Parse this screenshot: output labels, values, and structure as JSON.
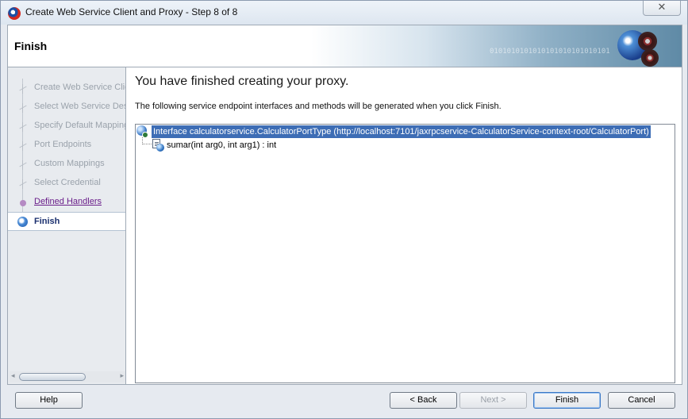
{
  "window": {
    "title": "Create Web Service Client and Proxy - Step 8 of 8",
    "close_glyph": "✕"
  },
  "banner": {
    "title": "Finish",
    "binary_text": "0101010101010101010101010101"
  },
  "steps": [
    {
      "label": "Create Web Service Client and Proxy",
      "state": "done"
    },
    {
      "label": "Select Web Service Description",
      "state": "done"
    },
    {
      "label": "Specify Default Mapping Options",
      "state": "done"
    },
    {
      "label": "Port Endpoints",
      "state": "done"
    },
    {
      "label": "Custom Mappings",
      "state": "done"
    },
    {
      "label": "Select Credential",
      "state": "done"
    },
    {
      "label": "Defined Handlers",
      "state": "link"
    },
    {
      "label": "Finish",
      "state": "current"
    }
  ],
  "main": {
    "heading": "You have finished creating your proxy.",
    "description": "The following service endpoint interfaces and methods will be generated when you click Finish.",
    "tree": {
      "interface_label": "Interface calculatorservice.CalculatorPortType (http://localhost:7101/jaxrpcservice-CalculatorService-context-root/CalculatorPort)",
      "method_label": "sumar(int arg0, int arg1) : int"
    }
  },
  "sidebar_scroll": {
    "left_arrow": "◂",
    "right_arrow": "▸"
  },
  "buttons": {
    "help": "Help",
    "back": "< Back",
    "next": "Next >",
    "finish": "Finish",
    "cancel": "Cancel"
  }
}
